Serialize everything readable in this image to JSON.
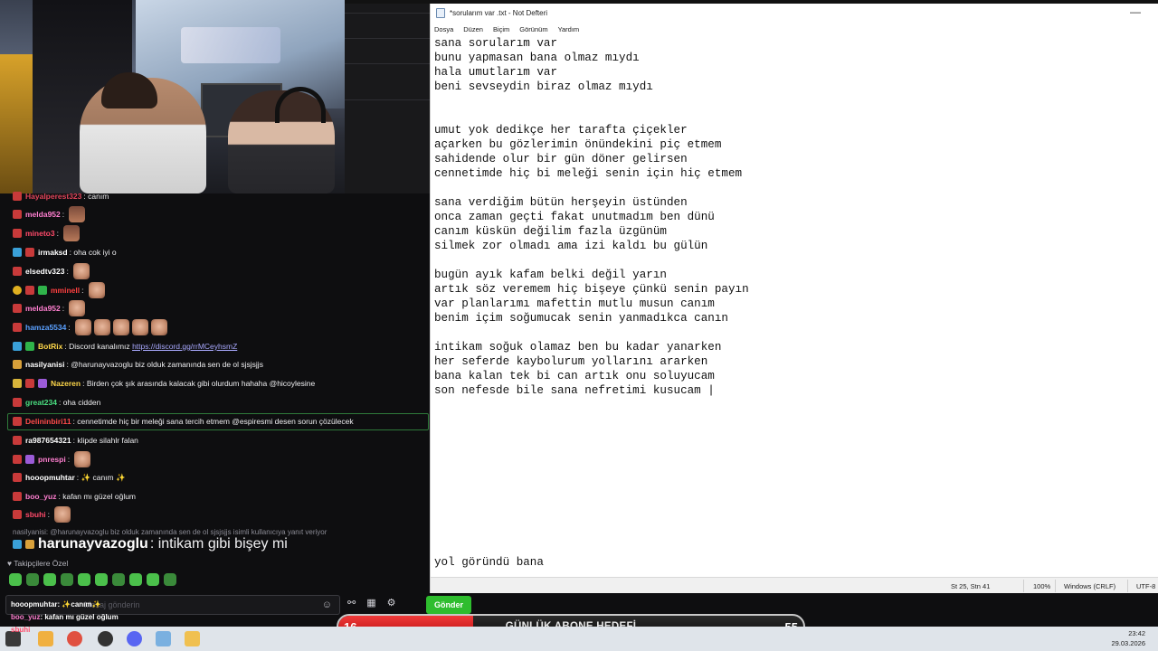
{
  "notepad": {
    "title": "*sorularım var .txt - Not Defteri",
    "menu": [
      "Dosya",
      "Düzen",
      "Biçim",
      "Görünüm",
      "Yardım"
    ],
    "lines": [
      "sana sorularım var",
      "bunu yapmasan bana olmaz mıydı",
      "hala umutlarım var",
      "beni sevseydin biraz olmaz mıydı",
      "",
      "",
      "umut yok dedikçe her tarafta çiçekler",
      "açarken bu gözlerimin önündekini piç etmem",
      "sahidende olur bir gün döner gelirsen",
      "cennetimde hiç bi meleği senin için hiç etmem",
      "",
      "sana verdiğim bütün herşeyin üstünden",
      "onca zaman geçti fakat unutmadım ben dünü",
      "canım küskün değilim fazla üzgünüm",
      "silmek zor olmadı ama izi kaldı bu gülün",
      "",
      "bugün ayık kafam belki değil yarın",
      "artık söz veremem hiç bişeye çünkü senin payın",
      "var planlarımı mafettin mutlu musun canım",
      "benim içim soğumucak senin yanmadıkca canın",
      "",
      "intikam soğuk olamaz ben bu kadar yanarken",
      "her seferde kaybolurum yollarını ararken",
      "bana kalan tek bi can artık onu soluyucam",
      "son nefesde bile sana nefretimi kusucam |"
    ],
    "bottom_line": "yol göründü bana",
    "status": {
      "position": "St 25, Stn 41",
      "zoom": "100%",
      "line_ending": "Windows (CRLF)",
      "encoding": "UTF-8"
    }
  },
  "chat": {
    "messages": [
      {
        "user": "Hayalperest323",
        "color": "#e0445a",
        "text": "canım",
        "badges": [
          "mod"
        ],
        "emotes": 0
      },
      {
        "user": "melda952",
        "color": "#ff7fd0",
        "text": "",
        "badges": [
          "mod"
        ],
        "emotes": 1
      },
      {
        "user": "mineto3",
        "color": "#ff4a6a",
        "text": "",
        "badges": [
          "mod"
        ],
        "emotes": 1
      },
      {
        "user": "irmaksd",
        "color": "#ffffff",
        "text": "oha cok iyi o",
        "badges": [
          "vip",
          "mod"
        ],
        "emotes": 0
      },
      {
        "user": "elsedtv323",
        "color": "#ffffff",
        "text": "",
        "badges": [
          "mod"
        ],
        "emotes": 1
      },
      {
        "user": "mminell",
        "color": "#ff4040",
        "text": "",
        "badges": [
          "yellow",
          "mod",
          "green"
        ],
        "emotes": 1
      },
      {
        "user": "melda952",
        "color": "#ff7fd0",
        "text": "",
        "badges": [
          "mod"
        ],
        "emotes": 1
      },
      {
        "user": "hamza5534",
        "color": "#5aa0ff",
        "text": "",
        "badges": [
          "mod"
        ],
        "emotes": 5
      },
      {
        "user": "BotRix",
        "color": "#ffd84a",
        "text": "Discord kanalımız",
        "link": "https://discord.gg/rrMCeyhsmZ",
        "badges": [
          "vip",
          "green"
        ],
        "emotes": 0
      },
      {
        "user": "nasilyanisi",
        "color": "#ffffff",
        "text": "@harunayvazoglu biz olduk zamanında sen de ol sjsjsjjs",
        "badges": [
          "sub"
        ],
        "emotes": 0
      },
      {
        "user": "Nazeren",
        "color": "#ffd84a",
        "text": "Birden çok şık arasında kalacak gibi olurdum hahaha @hicoylesine",
        "badges": [
          "crown",
          "mod",
          "purple"
        ],
        "emotes": 0
      },
      {
        "user": "great234",
        "color": "#4ade80",
        "text": "oha cidden",
        "badges": [
          "mod"
        ],
        "emotes": 0
      },
      {
        "user": "Delininbiri11",
        "color": "#ff4a4a",
        "text": "cennetimde hiç bir meleği sana tercih etmem @espiresmi desen sorun çözülecek",
        "badges": [
          "mod"
        ],
        "emotes": 0
      },
      {
        "user": "ra987654321",
        "color": "#ffffff",
        "text": "klipde silahlr falan",
        "badges": [
          "mod"
        ],
        "emotes": 0
      },
      {
        "user": "pnrespi",
        "color": "#ff7fd0",
        "text": "",
        "badges": [
          "mod",
          "purple"
        ],
        "emotes": 1
      },
      {
        "user": "hooopmuhtar",
        "color": "#ffffff",
        "text": "✨ canım ✨",
        "badges": [
          "mod"
        ],
        "emotes": 0
      },
      {
        "user": "boo_yuz",
        "color": "#ff7fd0",
        "text": "kafan mı güzel oğlum",
        "badges": [
          "mod"
        ],
        "emotes": 0
      },
      {
        "user": "sbuhi",
        "color": "#ff4a6a",
        "text": "",
        "badges": [
          "mod"
        ],
        "emotes": 1
      }
    ],
    "reply_hint": "nasilyanisi: @harunayvazoglu biz olduk zamanında sen de ol sjsjsjjs isimli kullanıcıya yanıt veriyor",
    "reply_message": {
      "user": "harunayvazoglu",
      "color": "#ffffff",
      "text": "intikam gibi bişey mi",
      "badges": [
        "vip",
        "sub"
      ]
    },
    "followers_label": "Takipçilere Özel",
    "input_placeholder": "Mesaj gönderin",
    "send_label": "Gönder"
  },
  "overlay_chat": [
    {
      "user": "hooopmuhtar",
      "text": ": ✨canım✨",
      "color": "#ffffff"
    },
    {
      "user": "boo_yuz",
      "text": ": kafan mı güzel oğlum",
      "color": "#ff7fd0"
    },
    {
      "user": "sbuhi",
      "text": "",
      "color": "#ff4a6a"
    }
  ],
  "goal": {
    "current": "16",
    "label": "GÜNLÜK ABONE HEDEFİ",
    "target": "55",
    "progress": 0.29
  },
  "taskbar": {
    "time": "23:42",
    "date": "29.03.2026"
  }
}
